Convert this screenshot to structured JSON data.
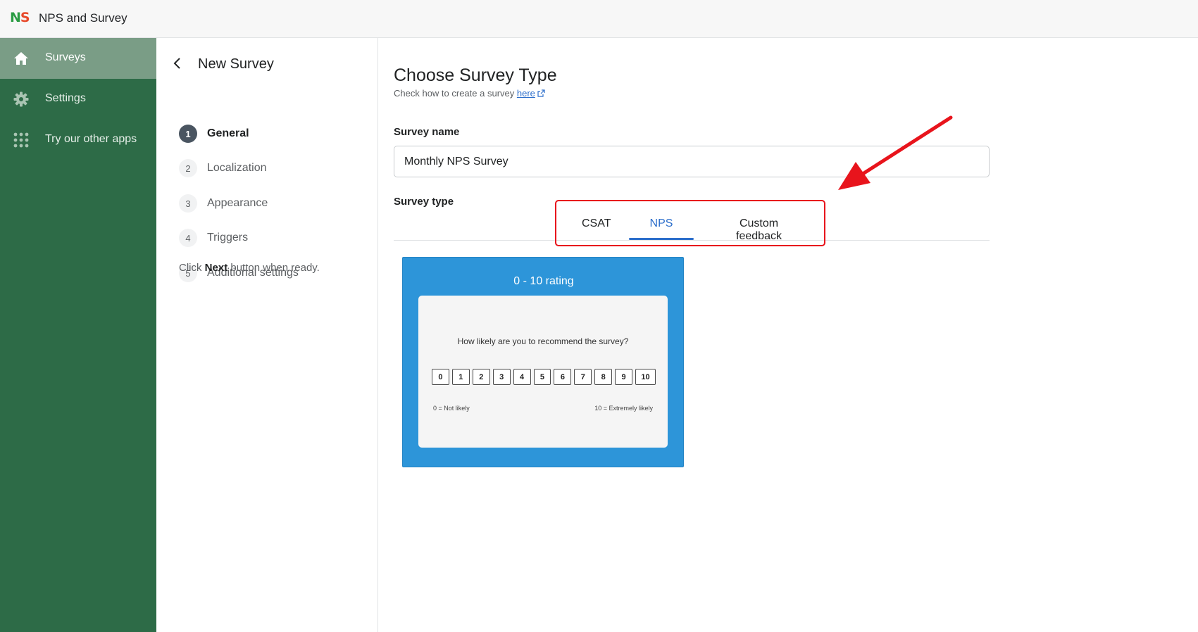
{
  "app": {
    "logo_n": "N",
    "logo_s": "S",
    "title": "NPS and Survey"
  },
  "sidebar": {
    "items": [
      {
        "label": "Surveys",
        "icon": "home-icon",
        "active": true
      },
      {
        "label": "Settings",
        "icon": "gear-icon",
        "active": false
      },
      {
        "label": "Try our other apps",
        "icon": "apps-grid-icon",
        "active": false
      }
    ]
  },
  "steps": {
    "title": "New Survey",
    "items": [
      {
        "num": "1",
        "label": "General",
        "active": true
      },
      {
        "num": "2",
        "label": "Localization",
        "active": false
      },
      {
        "num": "3",
        "label": "Appearance",
        "active": false
      },
      {
        "num": "4",
        "label": "Triggers",
        "active": false
      },
      {
        "num": "5",
        "label": "Additional settings",
        "active": false
      }
    ],
    "hint_prefix": "Click",
    "hint_bold": "Next",
    "hint_suffix": "button when ready."
  },
  "main": {
    "title": "Choose Survey Type",
    "subtitle": "Check how to create a survey",
    "subtitle_link": "here",
    "survey_name_label": "Survey name",
    "survey_name_value": "Monthly NPS Survey",
    "survey_type_label": "Survey type",
    "tabs": [
      {
        "label": "CSAT",
        "active": false
      },
      {
        "label": "NPS",
        "active": true
      },
      {
        "label": "Custom feedback",
        "active": false
      }
    ]
  },
  "preview": {
    "title": "0 - 10 rating",
    "question": "How likely are you to recommend the survey?",
    "scale": [
      "0",
      "1",
      "2",
      "3",
      "4",
      "5",
      "6",
      "7",
      "8",
      "9",
      "10"
    ],
    "min_label": "0 = Not likely",
    "max_label": "10 = Extremely likely"
  },
  "colors": {
    "sidebar": "#2d6b47",
    "sidebar_active": "#7a9d86",
    "accent": "#2c6ecb",
    "preview_bg": "#2d95d9",
    "annotation": "#e8141c"
  }
}
